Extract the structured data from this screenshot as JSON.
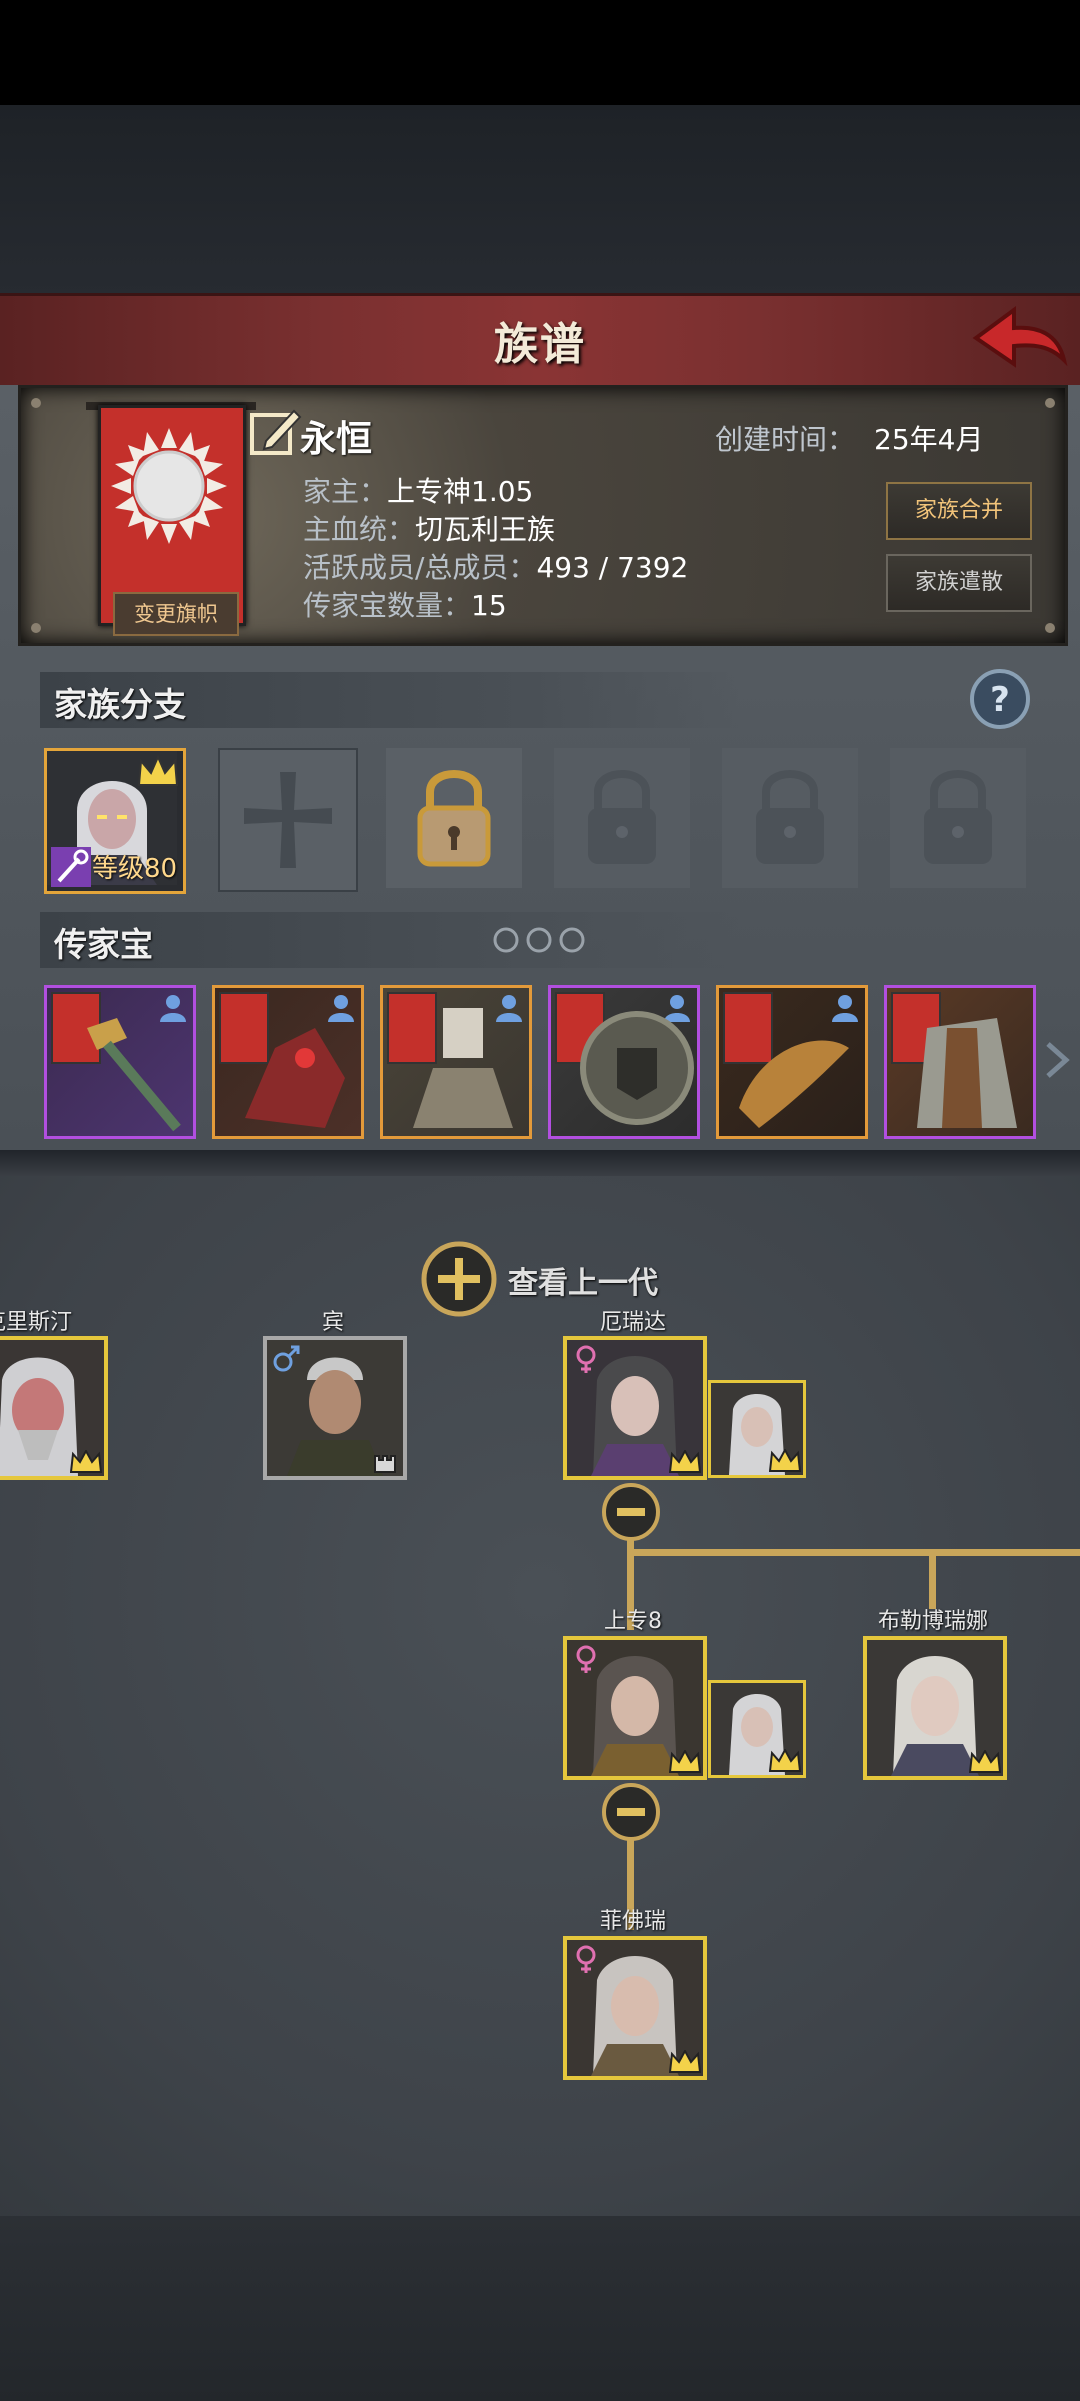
{
  "header": {
    "title": "族谱"
  },
  "family": {
    "name": "永恒",
    "created_label": "创建时间：",
    "created_value": "25年4月",
    "head_label": "家主：",
    "head_value": "上专神1.05",
    "bloodline_label": "主血统：",
    "bloodline_value": "切瓦利王族",
    "members_label": "活跃成员/总成员：",
    "members_value": "493 / 7392",
    "heirloom_count_label": "传家宝数量：",
    "heirloom_count_value": "15",
    "change_banner_label": "变更旗帜",
    "merge_label": "家族合并",
    "disband_label": "家族遣散"
  },
  "branches": {
    "title": "家族分支",
    "first_level_label": "等级80"
  },
  "heirlooms": {
    "title": "传家宝",
    "items": [
      {
        "rarity": "purple",
        "item": "hammer"
      },
      {
        "rarity": "orange",
        "item": "dark-creature"
      },
      {
        "rarity": "orange",
        "item": "warrior"
      },
      {
        "rarity": "purple",
        "item": "shield"
      },
      {
        "rarity": "orange",
        "item": "dragon-weapon"
      },
      {
        "rarity": "purple",
        "item": "armor"
      }
    ]
  },
  "tree": {
    "view_previous_label": "查看上一代",
    "members": {
      "kristin": "克里斯汀",
      "bin": "宾",
      "erida": "厄瑞达",
      "shangzhuan8": "上专8",
      "brevona": "布勒博瑞娜",
      "feifurui": "菲佛瑞"
    }
  },
  "colors": {
    "header_red": "#7a3030",
    "accent_gold": "#e5c73c",
    "rarity_purple": "#b24fe0",
    "rarity_orange": "#e39a3a",
    "tree_line": "#c9a65a"
  }
}
